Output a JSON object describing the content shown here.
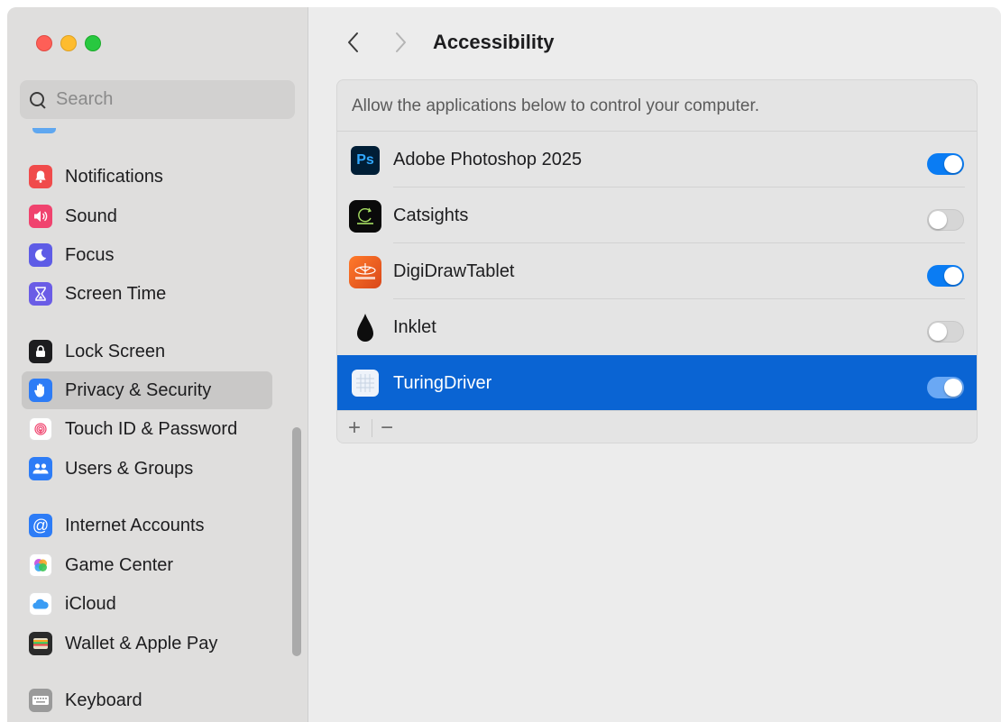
{
  "window": {
    "title": "Accessibility"
  },
  "sidebar": {
    "search": {
      "placeholder": "Search",
      "value": ""
    },
    "items": [
      {
        "label": "Notifications",
        "icon": "bell-icon",
        "color": "#f04b4b"
      },
      {
        "label": "Sound",
        "icon": "speaker-icon",
        "color": "#f0436e"
      },
      {
        "label": "Focus",
        "icon": "moon-icon",
        "color": "#5e5ce6"
      },
      {
        "label": "Screen Time",
        "icon": "hourglass-icon",
        "color": "#6a5ce6"
      },
      {
        "label": "Lock Screen",
        "icon": "lock-icon",
        "color": "#1d1d1f"
      },
      {
        "label": "Privacy & Security",
        "icon": "hand-icon",
        "color": "#2d7cf6",
        "selected": true
      },
      {
        "label": "Touch ID & Password",
        "icon": "fingerprint-icon",
        "color": "#ffffff"
      },
      {
        "label": "Users & Groups",
        "icon": "users-icon",
        "color": "#2d7cf6"
      },
      {
        "label": "Internet Accounts",
        "icon": "at-icon",
        "color": "#2d7cf6"
      },
      {
        "label": "Game Center",
        "icon": "game-center-icon",
        "color": "#ffffff"
      },
      {
        "label": "iCloud",
        "icon": "cloud-icon",
        "color": "#ffffff"
      },
      {
        "label": "Wallet & Apple Pay",
        "icon": "wallet-icon",
        "color": "#2a2a2a"
      },
      {
        "label": "Keyboard",
        "icon": "keyboard-icon",
        "color": "#9a9a9a"
      }
    ]
  },
  "main": {
    "description": "Allow the applications below to control your computer.",
    "apps": [
      {
        "name": "Adobe Photoshop 2025",
        "icon": "photoshop-icon",
        "icon_text": "Ps",
        "enabled": true,
        "selected": false
      },
      {
        "name": "Catsights",
        "icon": "catsights-icon",
        "enabled": false,
        "selected": false
      },
      {
        "name": "DigiDrawTablet",
        "icon": "digidraw-icon",
        "enabled": true,
        "selected": false
      },
      {
        "name": "Inklet",
        "icon": "ink-drop-icon",
        "enabled": false,
        "selected": false
      },
      {
        "name": "TuringDriver",
        "icon": "turingdriver-icon",
        "enabled": true,
        "selected": true
      }
    ],
    "footer": {
      "add_label": "+",
      "remove_label": "−"
    }
  },
  "colors": {
    "accent": "#0a7cf3",
    "selection": "#0a64d3"
  }
}
